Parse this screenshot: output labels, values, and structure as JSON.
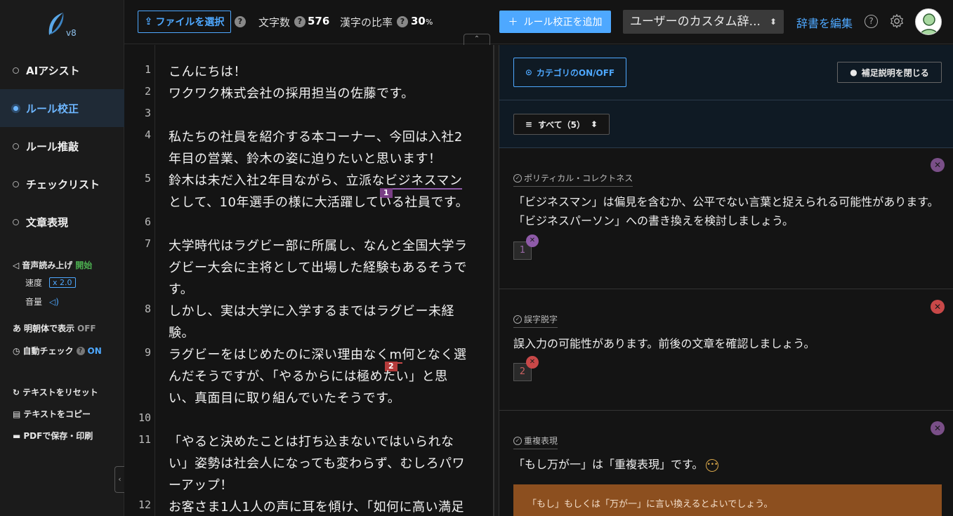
{
  "app": {
    "version": "v8"
  },
  "sidebar": {
    "items": [
      {
        "label": "AIアシスト"
      },
      {
        "label": "ルール校正"
      },
      {
        "label": "ルール推敲"
      },
      {
        "label": "チェックリスト"
      },
      {
        "label": "文章表現"
      }
    ],
    "voice": {
      "label": "音声読み上げ",
      "start": "開始",
      "speed_label": "速度",
      "speed_value": "x 2.0",
      "volume_label": "音量"
    },
    "mincho": {
      "label": "明朝体で表示",
      "state": "OFF"
    },
    "autocheck": {
      "label": "自動チェック",
      "state": "ON"
    },
    "actions": [
      {
        "label": "テキストをリセット"
      },
      {
        "label": "テキストをコピー"
      },
      {
        "label": "PDFで保存・印刷"
      }
    ]
  },
  "toolbar": {
    "file_button": "ファイルを選択",
    "char_count_label": "文字数",
    "char_count": "576",
    "kanji_ratio_label": "漢字の比率",
    "kanji_ratio": "30",
    "kanji_ratio_unit": "%",
    "add_rule_button": "ルール校正を追加",
    "dictionary_select": "ユーザーのカスタム辞...",
    "edit_dictionary": "辞書を編集"
  },
  "editor": {
    "line_numbers": [
      "1",
      "2",
      "3",
      "4",
      "5",
      "6",
      "7",
      "8",
      "9",
      "10",
      "11",
      "12"
    ],
    "lines": {
      "l1": "こんにちは！",
      "l2": "ワクワク株式会社の採用担当の佐藤です。",
      "l4a": "私たちの社員を紹介する本コーナー、今回は入社2",
      "l4b": "年目の営業、鈴木の姿に迫りたいと思います！",
      "l5a_pre": "鈴木は未だ入社2年目ながら、立派な",
      "l5a_hl": "ビジネスマン",
      "l5b": "として、10年選手の様に大活躍している社員です。",
      "l7a": "大学時代はラグビー部に所属し、なんと全国大学ラ",
      "l7b": "グビー大会に主将として出場した経験もあるそうで",
      "l7c": "す。",
      "l8a": "しかし、実は大学に入学するまではラグビー未経",
      "l8b": "験。",
      "l9a_pre": "ラグビーをはじめたのに深い理由なく",
      "l9a_hl": "m",
      "l9a_post": "何となく選",
      "l9b": "んだそうですが、「やるからには極めたい」と思",
      "l9c": "い、真面目に取り組んでいたそうです。",
      "l11a": "「やると決めたことは打ち込まないではいられな",
      "l11b": "い」姿勢は社会人になっても変わらず、むしろパワ",
      "l11c": "ーアップ！",
      "l12a": "お客さま1人1人の声に耳を傾け、「如何に高い満足"
    },
    "marks": [
      "1",
      "2"
    ]
  },
  "panel": {
    "category_toggle": "カテゴリのON/OFF",
    "close_notes": "補足説明を閉じる",
    "filter": "すべて（5）",
    "cards": [
      {
        "category": "ポリティカル・コレクトネス",
        "message_1": "「ビジネスマン」は偏見を含むか、公平でない言葉と捉えられる可能性があります。",
        "message_2": "「ビジネスパーソン」への書き換えを検討しましょう。",
        "chip": "1",
        "color": "#8e5aa8"
      },
      {
        "category": "誤字脱字",
        "message_1": "誤入力の可能性があります。前後の文章を確認しましょう。",
        "chip": "2",
        "color": "#c84848"
      },
      {
        "category": "重複表現",
        "message_1": "「もし万が一」は「重複表現」です。",
        "advice": "「もし」もしくは「万が一」に言い換えるとよいでしょう。",
        "color": "#7a4f88"
      }
    ]
  },
  "colors": {
    "accent": "#4ea8ff",
    "purple": "#8e5aa8",
    "red": "#c84848",
    "advice_bg": "#8c4f1f"
  }
}
